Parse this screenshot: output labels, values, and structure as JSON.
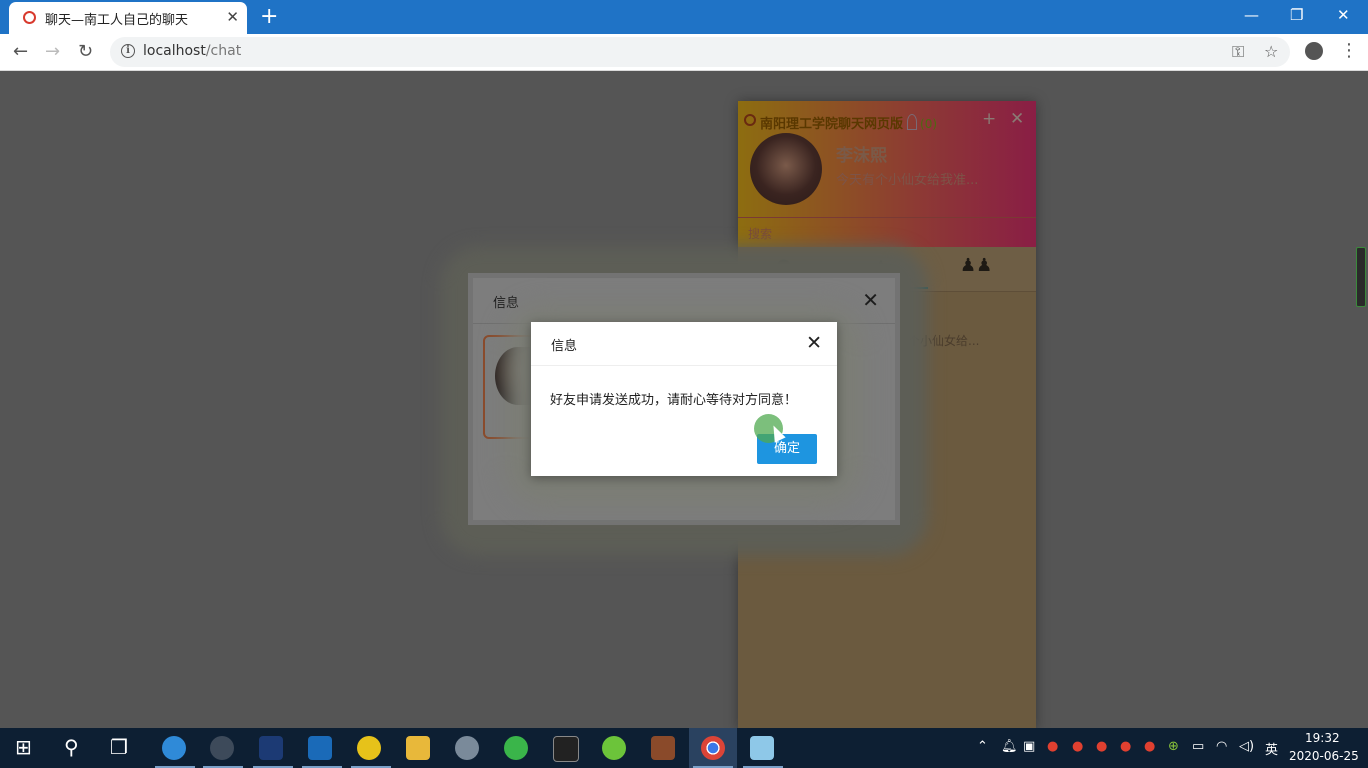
{
  "browser": {
    "tab_title": "聊天—南工人自己的聊天",
    "tab_close": "✕",
    "new_tab": "+",
    "url_host": "localhost",
    "url_path": "/chat",
    "window_controls": {
      "minimize": "—",
      "restore": "❐",
      "close": "✕"
    }
  },
  "chat_panel": {
    "title": "南阳理工学院聊天网页版",
    "online_count": "(0)",
    "user_name": "李沫熙",
    "signature": "今天有个小仙女给我准...",
    "search_placeholder": "搜索",
    "friend_snippet": "有个小仙女给...",
    "tabs": [
      "chat-icon",
      "contact-icon",
      "group-icon"
    ]
  },
  "outer_dialog": {
    "title": "信息",
    "close": "✕"
  },
  "inner_dialog": {
    "title": "信息",
    "close": "✕",
    "message": "好友申请发送成功，请耐心等待对方同意！",
    "confirm_label": "确定"
  },
  "taskbar": {
    "time": "19:32",
    "date": "2020-06-25",
    "ime": "英"
  },
  "colors": {
    "titlebar": "#1f73c6",
    "confirm_button": "#1e95e0",
    "chat_header_gradient": [
      "#8d6d10",
      "#8a1e45"
    ]
  }
}
